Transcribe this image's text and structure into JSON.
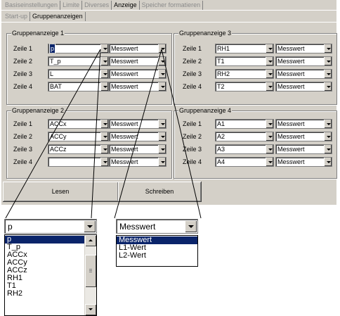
{
  "tabs_row1": [
    "Basiseinstellungen",
    "Limite",
    "Diverses",
    "Anzeige",
    "Speicher formatieren"
  ],
  "tabs_row2": [
    "Start-up",
    "Gruppenanzeigen"
  ],
  "groups": [
    {
      "title": "Gruppenanzeige 1",
      "rows": [
        {
          "label": "Zeile 1",
          "value": "p",
          "mode": "Messwert"
        },
        {
          "label": "Zeile 2",
          "value": "T_p",
          "mode": "Messwert"
        },
        {
          "label": "Zeile 3",
          "value": "L",
          "mode": "Messwert"
        },
        {
          "label": "Zeile 4",
          "value": "BAT",
          "mode": "Messwert"
        }
      ]
    },
    {
      "title": "Gruppenanzeige 3",
      "rows": [
        {
          "label": "Zeile 1",
          "value": "RH1",
          "mode": "Messwert"
        },
        {
          "label": "Zeile 2",
          "value": "T1",
          "mode": "Messwert"
        },
        {
          "label": "Zeile 3",
          "value": "RH2",
          "mode": "Messwert"
        },
        {
          "label": "Zeile 4",
          "value": "T2",
          "mode": "Messwert"
        }
      ]
    },
    {
      "title": "Gruppenanzeige 2",
      "rows": [
        {
          "label": "Zeile 1",
          "value": "ACCx",
          "mode": "Messwert"
        },
        {
          "label": "Zeile 2",
          "value": "ACCy",
          "mode": "Messwert"
        },
        {
          "label": "Zeile 3",
          "value": "ACCz",
          "mode": "Messwert"
        },
        {
          "label": "Zeile 4",
          "value": "",
          "mode": "Messwert"
        }
      ]
    },
    {
      "title": "Gruppenanzeige 4",
      "rows": [
        {
          "label": "Zeile 1",
          "value": "A1",
          "mode": "Messwert"
        },
        {
          "label": "Zeile 2",
          "value": "A2",
          "mode": "Messwert"
        },
        {
          "label": "Zeile 3",
          "value": "A3",
          "mode": "Messwert"
        },
        {
          "label": "Zeile 4",
          "value": "A4",
          "mode": "Messwert"
        }
      ]
    }
  ],
  "buttons": {
    "read": "Lesen",
    "write": "Schreiben"
  },
  "zoom_value_combo": {
    "value": "p",
    "options": [
      "p",
      "T_p",
      "ACCx",
      "ACCy",
      "ACCz",
      "RH1",
      "T1",
      "RH2"
    ],
    "highlighted": "p"
  },
  "zoom_mode_combo": {
    "value": "Messwert",
    "options": [
      "Messwert",
      "L1-Wert",
      "L2-Wert"
    ],
    "highlighted": "Messwert"
  },
  "colors": {
    "panel": "#d4d0c8",
    "selection": "#0a246a"
  }
}
